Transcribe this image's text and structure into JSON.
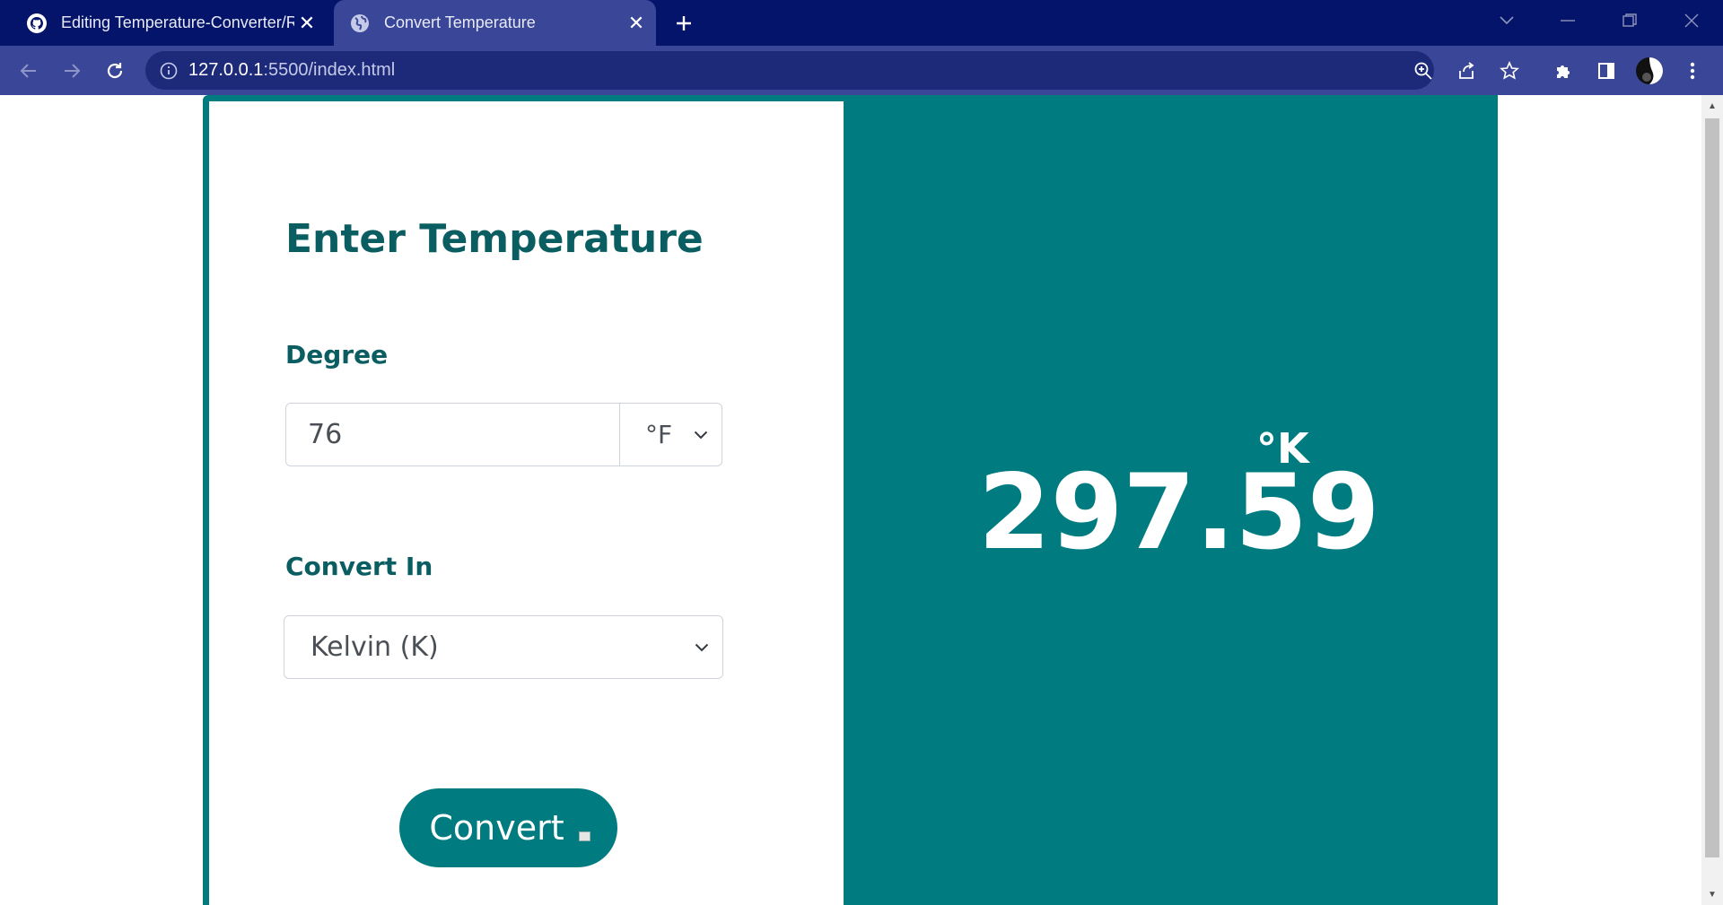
{
  "browser": {
    "tabs": [
      {
        "title": "Editing Temperature-Converter/R",
        "favicon": "github-icon",
        "active": false
      },
      {
        "title": "Convert Temperature",
        "favicon": "globe-icon",
        "active": true
      }
    ],
    "address": {
      "host": "127.0.0.1",
      "path": ":5500/index.html"
    }
  },
  "form": {
    "heading": "Enter Temperature",
    "degree_label": "Degree",
    "degree_value": "76",
    "unit_selected": "°F",
    "convert_label": "Convert In",
    "convert_selected": "Kelvin (K)",
    "convert_button": "Convert"
  },
  "result": {
    "value": "297.59",
    "unit": "°K"
  },
  "colors": {
    "accent": "#007b80",
    "heading": "#0a5d61",
    "tabbar": "#03146a",
    "toolbar": "#3a4698"
  }
}
